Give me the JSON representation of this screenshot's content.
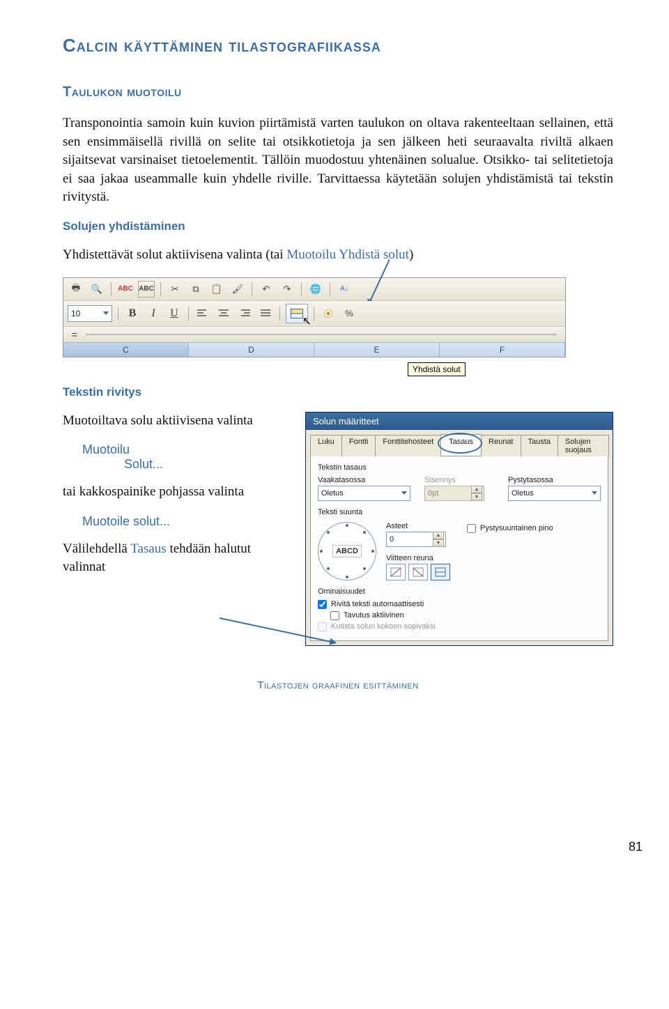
{
  "h1": "Calcin käyttäminen tilastografiikassa",
  "h2": "Taulukon muotoilu",
  "p1": "Transponointia samoin kuin kuvion piirtämistä varten taulukon on oltava rakenteeltaan sellainen, että sen ensimmäisellä rivillä on selite tai otsikkotietoja ja sen jälkeen heti seuraavalta riviltä alkaen sijaitsevat varsinaiset tietoelementit. Tällöin muodostuu yhtenäinen solualue. Otsikko- tai selitetietoja ei saa jakaa useammalle kuin yhdelle riville. Tarvittaessa käytetään solujen yhdistämistä tai tekstin rivitystä.",
  "h3a": "Solujen yhdistäminen",
  "p2_pre": "Yhdistettävät solut aktiivisena valinta (tai ",
  "p2_link": "Muotoilu Yhdistä solut",
  "p2_post": ")",
  "ss1": {
    "fontsize": "10",
    "tooltip": "Yhdistä solut",
    "cols": [
      "C",
      "D",
      "E",
      "F"
    ]
  },
  "h3b": "Tekstin rivitys",
  "p3": "Muotoiltava solu aktiivisena valinta",
  "menu1a": "Muotoilu",
  "menu1b": "Solut...",
  "p4": "tai kakkospainike pohjassa valinta",
  "menu2": "Muotoile solut...",
  "p5_pre": "Välilehdellä ",
  "p5_link": "Tasaus",
  "p5_post": " tehdään halutut valinnat",
  "ss2": {
    "title": "Solun määritteet",
    "tabs": [
      "Luku",
      "Fontti",
      "Fonttitehosteet",
      "Tasaus",
      "Reunat",
      "Tausta",
      "Solujen suojaus"
    ],
    "active_tab": 3,
    "group_align": "Tekstin tasaus",
    "lbl_h": "Vaakatasossa",
    "val_h": "Oletus",
    "lbl_indent": "Sisennys",
    "val_indent": "0pt",
    "lbl_v": "Pystytasossa",
    "val_v": "Oletus",
    "group_dir": "Teksti suunta",
    "lbl_deg": "Asteet",
    "val_deg": "0",
    "cb_vert": "Pystysuuntainen pino",
    "lbl_edge": "Viitteen reuna",
    "abcd": "ABCD",
    "group_props": "Ominaisuudet",
    "cb_wrap": "Rivitä teksti automaattisesti",
    "cb_hyph": "Tavutus aktiivinen",
    "cb_shrink": "Kutista solun kokoon sopivaksi"
  },
  "page_num": "81",
  "footer": "Tilastojen graafinen esittäminen"
}
